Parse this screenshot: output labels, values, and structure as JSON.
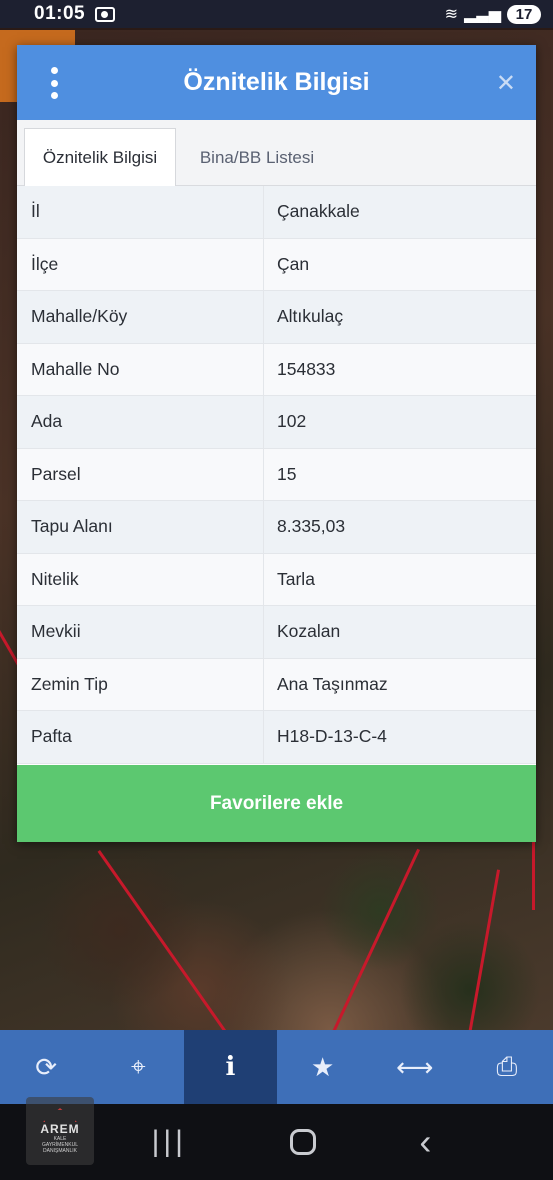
{
  "status_bar": {
    "time": "01:05",
    "battery": "17",
    "wifi_icon": "wifi-icon",
    "signal_icon": "signal-icon"
  },
  "dialog": {
    "title": "Öznitelik Bilgisi",
    "menu_icon": "vertical-dots-icon",
    "close_icon": "close-icon",
    "tabs": [
      {
        "label": "Öznitelik Bilgisi",
        "active": true
      },
      {
        "label": "Bina/BB Listesi",
        "active": false
      }
    ],
    "rows": [
      {
        "label": "İl",
        "value": "Çanakkale"
      },
      {
        "label": "İlçe",
        "value": "Çan"
      },
      {
        "label": "Mahalle/Köy",
        "value": "Altıkulaç"
      },
      {
        "label": "Mahalle No",
        "value": "154833"
      },
      {
        "label": "Ada",
        "value": "102"
      },
      {
        "label": "Parsel",
        "value": "15"
      },
      {
        "label": "Tapu Alanı",
        "value": "8.335,03"
      },
      {
        "label": "Nitelik",
        "value": "Tarla"
      },
      {
        "label": "Mevkii",
        "value": "Kozalan"
      },
      {
        "label": "Zemin Tip",
        "value": "Ana Taşınmaz"
      },
      {
        "label": "Pafta",
        "value": "H18-D-13-C-4"
      }
    ],
    "favorite_button": "Favorilere ekle"
  },
  "toolbar": {
    "items": [
      {
        "icon": "refresh-icon",
        "glyph": "⟳",
        "active": false
      },
      {
        "icon": "crosshair-icon",
        "glyph": "⌖",
        "active": false
      },
      {
        "icon": "info-icon",
        "glyph": "i",
        "active": true
      },
      {
        "icon": "star-icon",
        "glyph": "★",
        "active": false
      },
      {
        "icon": "measure-icon",
        "glyph": "⟷",
        "active": false
      },
      {
        "icon": "print-icon",
        "glyph": "⎙",
        "active": false
      }
    ]
  },
  "navbar": {
    "recent_glyph": "|||",
    "back_glyph": "‹"
  },
  "logo": {
    "name": "AREM",
    "sub1": "KALE",
    "sub2": "GAYRİMENKUL DANIŞMANLIK"
  },
  "colors": {
    "header": "#4f8fe0",
    "favorite": "#5cc870",
    "toolbar": "#3e6fb8",
    "toolbar_active": "#1f3f74"
  }
}
